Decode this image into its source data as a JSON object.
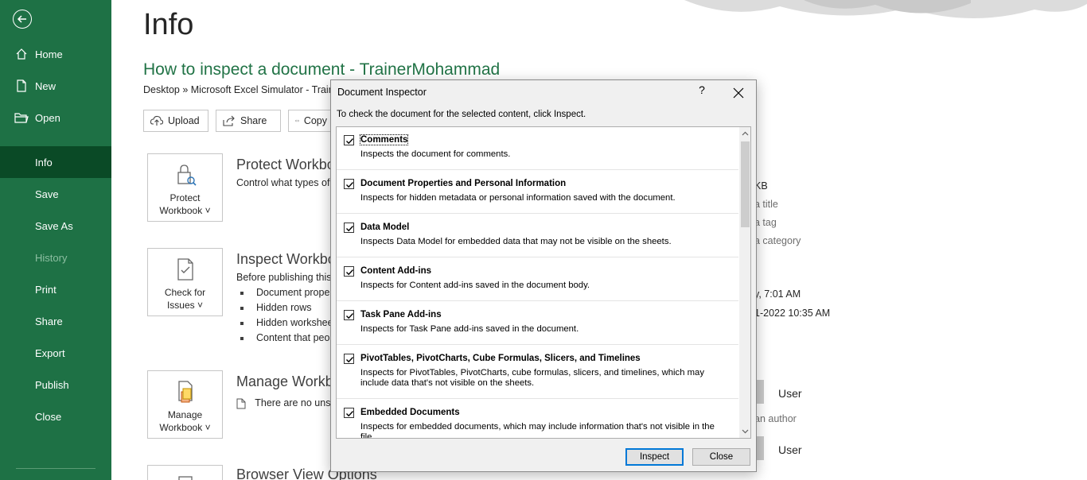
{
  "sidebar": {
    "items": [
      {
        "label": "Home"
      },
      {
        "label": "New"
      },
      {
        "label": "Open"
      },
      {
        "label": "Info"
      },
      {
        "label": "Save"
      },
      {
        "label": "Save As"
      },
      {
        "label": "History"
      },
      {
        "label": "Print"
      },
      {
        "label": "Share"
      },
      {
        "label": "Export"
      },
      {
        "label": "Publish"
      },
      {
        "label": "Close"
      }
    ]
  },
  "page": {
    "title": "Info",
    "doc_title": "How to inspect a document - TrainerMohammad",
    "doc_path": "Desktop » Microsoft Excel Simulator - Trainer",
    "buttons": {
      "upload": "Upload",
      "share": "Share",
      "copy": "Copy"
    }
  },
  "sections": {
    "protect": {
      "card_line1": "Protect",
      "card_line2": "Workbook",
      "title": "Protect Workbook",
      "desc": "Control what types of changes people can make to this workbook."
    },
    "inspect": {
      "card_line1": "Check for",
      "card_line2": "Issues",
      "title": "Inspect Workbook",
      "desc": "Before publishing this file, be aware that it contains:",
      "bullets": [
        "Document properties",
        "Hidden rows",
        "Hidden worksheets",
        "Content that people"
      ]
    },
    "manage": {
      "card_line1": "Manage",
      "card_line2": "Workbook",
      "title": "Manage Workbook",
      "desc": "There are no unsaved changes."
    },
    "browser": {
      "title": "Browser View Options"
    }
  },
  "properties": {
    "size": "KB",
    "title": "a title",
    "tags": "a tag",
    "categories": "a category",
    "modified": "y, 7:01 AM",
    "created": "1-2022 10:35 AM",
    "author": "User",
    "add_author": "an author",
    "last_modified_by": "User"
  },
  "dialog": {
    "title": "Document Inspector",
    "help": "?",
    "instruction": "To check the document for the selected content, click Inspect.",
    "items": [
      {
        "title": "Comments",
        "desc": "Inspects the document for comments.",
        "checked": true
      },
      {
        "title": "Document Properties and Personal Information",
        "desc": "Inspects for hidden metadata or personal information saved with the document.",
        "checked": true
      },
      {
        "title": "Data Model",
        "desc": "Inspects Data Model for embedded data that may not be visible on the sheets.",
        "checked": true
      },
      {
        "title": "Content Add-ins",
        "desc": "Inspects for Content add-ins saved in the document body.",
        "checked": true
      },
      {
        "title": "Task Pane Add-ins",
        "desc": "Inspects for Task Pane add-ins saved in the document.",
        "checked": true
      },
      {
        "title": "PivotTables, PivotCharts, Cube Formulas, Slicers, and Timelines",
        "desc": "Inspects for PivotTables, PivotCharts, cube formulas, slicers, and timelines, which may include data that's not visible on the sheets.",
        "checked": true
      },
      {
        "title": "Embedded Documents",
        "desc": "Inspects for embedded documents, which may include information that's not visible in the file.",
        "checked": true
      }
    ],
    "inspect_label": "Inspect",
    "close_label": "Close"
  },
  "colors": {
    "sidebar": "#1e7145",
    "sidebar_active": "#0a4a26",
    "accent": "#217346",
    "dialog_bg": "#f0f0f0"
  }
}
